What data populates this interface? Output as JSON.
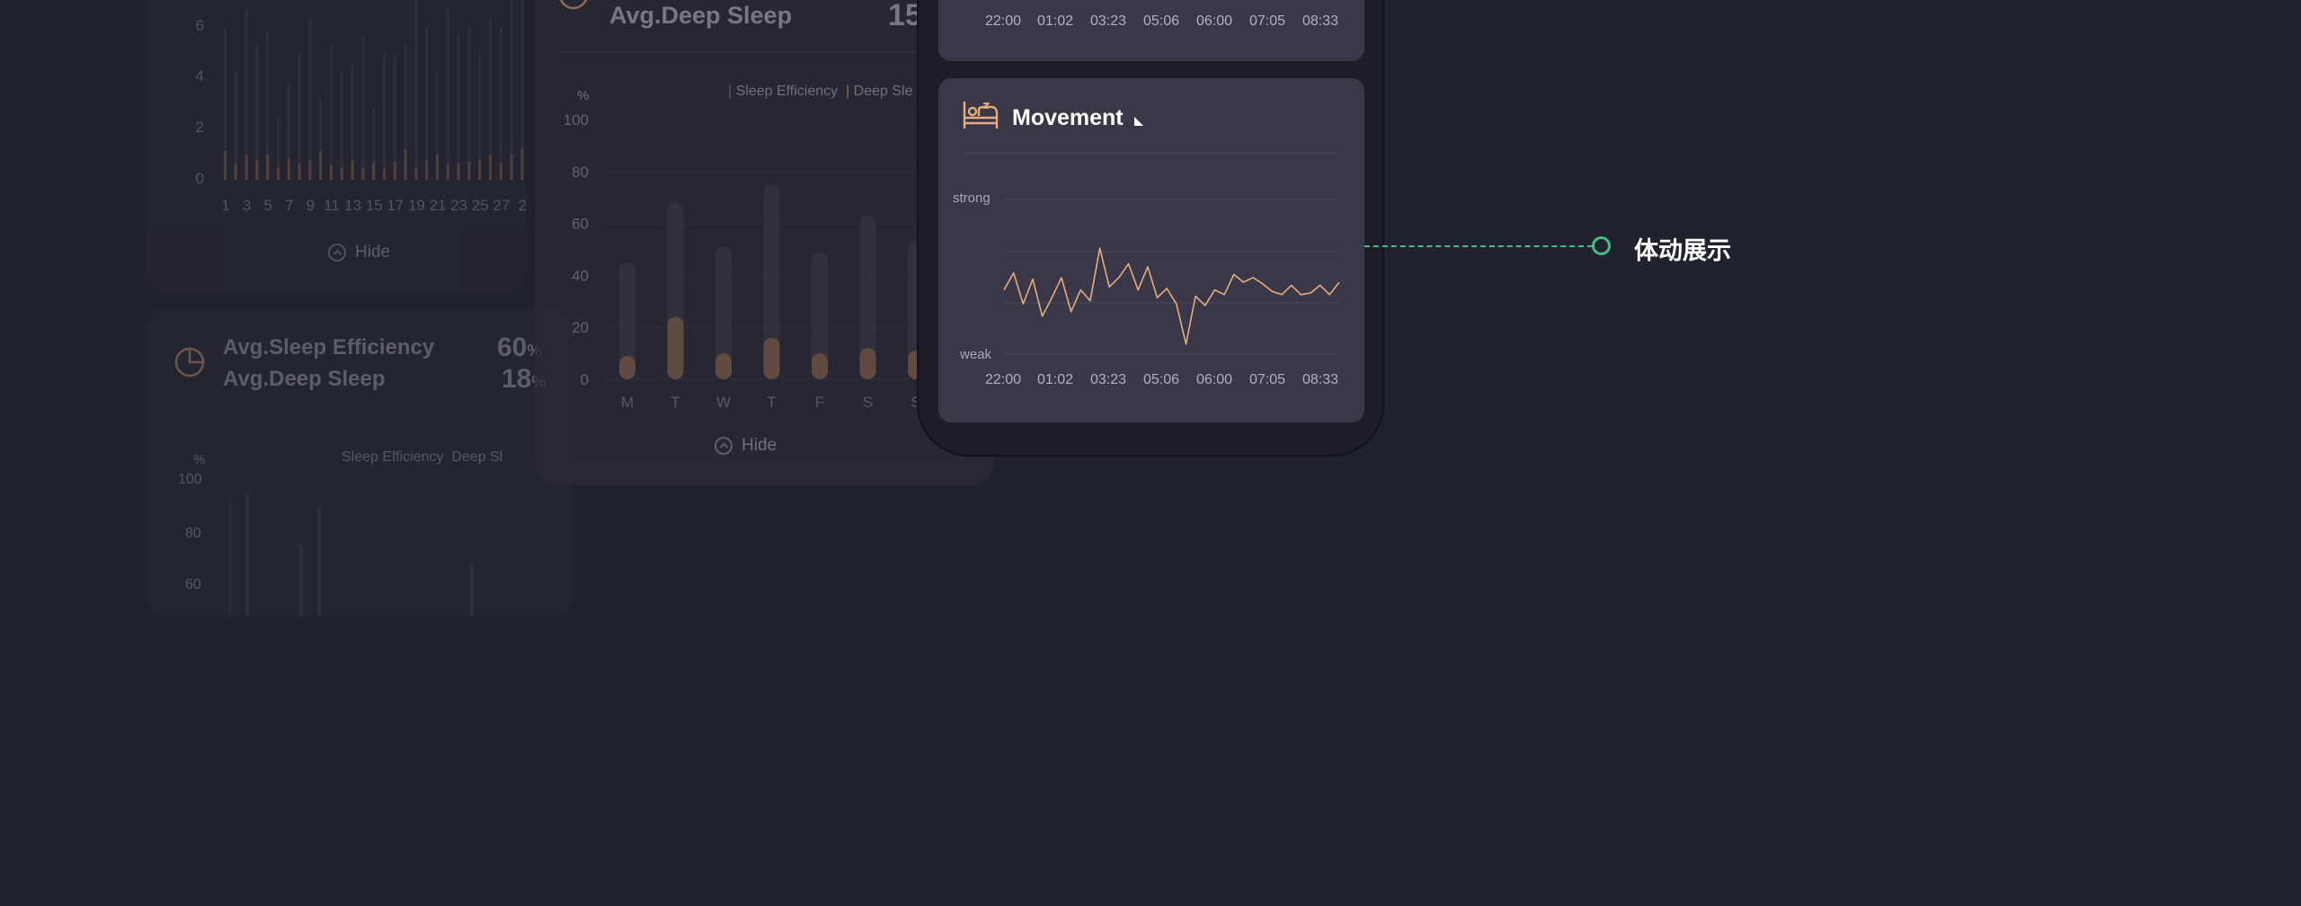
{
  "background_cards": {
    "monthly": {
      "y_ticks": [
        "6",
        "4",
        "2",
        "0"
      ],
      "x_ticks": [
        "1",
        "3",
        "5",
        "7",
        "9",
        "11",
        "13",
        "15",
        "17",
        "19",
        "21",
        "23",
        "25",
        "27",
        "2"
      ],
      "hide_label": "Hide"
    },
    "efficiency_small": {
      "line1": "Avg.Sleep Efficiency",
      "line2": "Avg.Deep Sleep",
      "value1": "60",
      "value2": "18",
      "unit": "%",
      "legend": [
        "Sleep Efficiency",
        "Deep Sl"
      ],
      "y_unit": "%",
      "y_ticks": [
        "100",
        "80",
        "60"
      ]
    },
    "weekly": {
      "title": "Avg.Deep Sleep",
      "value": "15",
      "legend": [
        "Sleep Efficiency",
        "Deep Sle"
      ],
      "y_unit": "%",
      "y_ticks": [
        "100",
        "80",
        "60",
        "40",
        "20",
        "0"
      ],
      "days": [
        "M",
        "T",
        "W",
        "T",
        "F",
        "S",
        "S"
      ],
      "hide_label": "Hide"
    }
  },
  "phone": {
    "top_panel": {
      "times": [
        "22:00",
        "01:02",
        "03:23",
        "05:06",
        "06:00",
        "07:05",
        "08:33"
      ]
    },
    "movement": {
      "title": "Movement",
      "icon": "bed-icon",
      "axis_top": "strong",
      "axis_bottom": "weak",
      "times": [
        "22:00",
        "01:02",
        "03:23",
        "05:06",
        "06:00",
        "07:05",
        "08:33"
      ],
      "line_color": "#e6ad7d"
    }
  },
  "annotation": {
    "label": "体动展示",
    "color": "#3fbf86"
  }
}
